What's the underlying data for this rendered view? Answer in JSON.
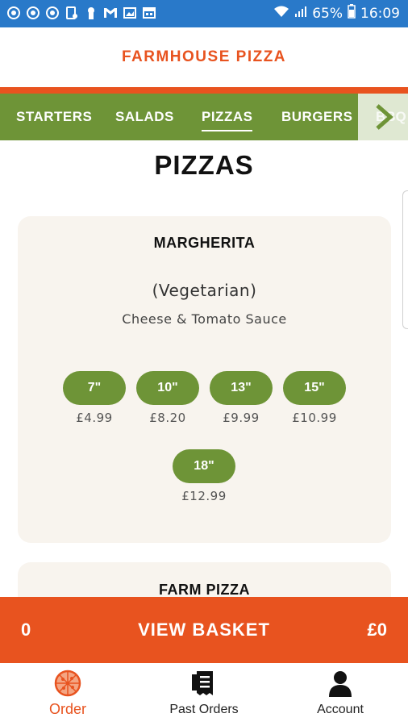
{
  "status_bar": {
    "battery": "65%",
    "time": "16:09"
  },
  "header": {
    "title": "FARMHOUSE PIZZA"
  },
  "categories": {
    "tabs": [
      "STARTERS",
      "SALADS",
      "PIZZAS",
      "BURGERS"
    ],
    "partial_next": "BBQ S",
    "active": "PIZZAS"
  },
  "section": {
    "title": "PIZZAS"
  },
  "items": [
    {
      "name": "MARGHERITA",
      "dietary": "(Vegetarian)",
      "description": "Cheese & Tomato Sauce",
      "sizes": [
        {
          "size": "7\"",
          "price": "£4.99"
        },
        {
          "size": "10\"",
          "price": "£8.20"
        },
        {
          "size": "13\"",
          "price": "£9.99"
        },
        {
          "size": "15\"",
          "price": "£10.99"
        },
        {
          "size": "18\"",
          "price": "£12.99"
        }
      ]
    },
    {
      "name": "FARM PIZZA"
    }
  ],
  "basket": {
    "count": "0",
    "label": "VIEW BASKET",
    "total": "£0"
  },
  "bottom_nav": [
    {
      "label": "Order",
      "icon": "pizza-icon",
      "active": true
    },
    {
      "label": "Past Orders",
      "icon": "receipt-icon",
      "active": false
    },
    {
      "label": "Account",
      "icon": "user-icon",
      "active": false
    }
  ],
  "colors": {
    "accent": "#e8531f",
    "green": "#6e9437",
    "card_bg": "#f8f4ee",
    "status_bar": "#2979c9"
  }
}
